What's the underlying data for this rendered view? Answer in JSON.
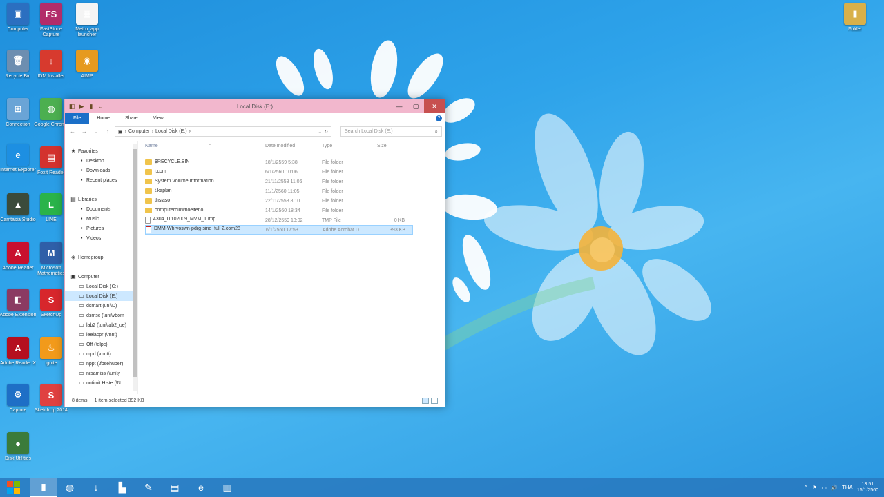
{
  "desktop": {
    "icons": [
      {
        "label": "Computer",
        "glyph": "▣",
        "color": "#2b6fc0"
      },
      {
        "label": "FastStone Capture",
        "glyph": "FS",
        "color": "#b22c6a"
      },
      {
        "label": "Metro_app launcher",
        "glyph": "▦",
        "color": "#f4f4f4"
      },
      {
        "label": "Recycle Bin",
        "glyph": "🗑",
        "color": "#6d8eb0"
      },
      {
        "label": "IDM Installer",
        "glyph": "↓",
        "color": "#d73a2e"
      },
      {
        "label": "AIMP",
        "glyph": "◉",
        "color": "#e69a1f"
      },
      {
        "label": "Connection",
        "glyph": "⊞",
        "color": "#6aa4d6"
      },
      {
        "label": "Google Chrome",
        "glyph": "◍",
        "color": "#4caf50"
      },
      {
        "label": "Internet Explorer",
        "glyph": "e",
        "color": "#1d8fe2"
      },
      {
        "label": "Foxit Reader",
        "glyph": "▤",
        "color": "#d3322e"
      },
      {
        "label": "Camtasia Studio",
        "glyph": "▲",
        "color": "#3b4b3b"
      },
      {
        "label": "LINE",
        "glyph": "L",
        "color": "#2ab34a"
      },
      {
        "label": "Adobe Reader",
        "glyph": "A",
        "color": "#c8102e"
      },
      {
        "label": "Microsoft Mathematics",
        "glyph": "M",
        "color": "#2f5fa8"
      },
      {
        "label": "Adobe Extension",
        "glyph": "◧",
        "color": "#8b3a62"
      },
      {
        "label": "SketchUp",
        "glyph": "S",
        "color": "#d7262c"
      },
      {
        "label": "Adobe Reader X",
        "glyph": "A",
        "color": "#b50f1f"
      },
      {
        "label": "Ignite",
        "glyph": "♨",
        "color": "#f29a1b"
      },
      {
        "label": "Capture",
        "glyph": "⚙",
        "color": "#1e6fc6"
      },
      {
        "label": "SketchUp 2014",
        "glyph": "S",
        "color": "#e04040"
      },
      {
        "label": "Disk Utilities",
        "glyph": "●",
        "color": "#3b7b3b"
      },
      {
        "label": "Folder",
        "glyph": "▮",
        "color": "#d8b04a"
      }
    ]
  },
  "window": {
    "title": "Local Disk (E:)",
    "quick_access": [
      "◧",
      "▶",
      "▮",
      "⌄"
    ],
    "controls": {
      "minimize": "—",
      "maximize": "▢",
      "close": "✕"
    },
    "ribbon_tabs": [
      "File",
      "Home",
      "Share",
      "View"
    ],
    "help": "?",
    "address": {
      "parts": [
        "Computer",
        "Local Disk (E:)"
      ],
      "sep": "›",
      "dropdown": "⌄",
      "refresh": "↻"
    },
    "search_placeholder": "Search Local Disk (E:)",
    "nav_buttons": [
      "←",
      "→",
      "⌄",
      "↑"
    ],
    "nav_pane": {
      "favorites": {
        "label": "Favorites",
        "items": [
          "Desktop",
          "Downloads",
          "Recent places"
        ]
      },
      "libraries": {
        "label": "Libraries",
        "items": [
          "Documents",
          "Music",
          "Pictures",
          "Videos"
        ]
      },
      "homegroup": "Homegroup",
      "computer": {
        "label": "Computer",
        "items": [
          "Local Disk (C:)",
          "Local Disk (E:)",
          "dsmart (uni\\D)",
          "dsmsc (\\uni\\vbom",
          "lab2 (\\uni\\lab2_ue)",
          "leeiacpr (\\mnt)",
          "Off (\\olpc)",
          "mpd (\\mnt\\)",
          "nppt (\\fbsehuper)",
          "nrsamiss (\\uni\\y",
          "nntimit Histe (\\N"
        ]
      }
    },
    "columns": {
      "name": "Name",
      "date": "Date modified",
      "type": "Type",
      "size": "Size"
    },
    "files": [
      {
        "name": "$RECYCLE.BIN",
        "date": "18/1/2559 5:38",
        "type": "File folder",
        "size": "",
        "kind": "folder"
      },
      {
        "name": "i.com",
        "date": "6/1/2560 10:06",
        "type": "File folder",
        "size": "",
        "kind": "folder"
      },
      {
        "name": "System Volume Information",
        "date": "21/11/2558 11:06",
        "type": "File folder",
        "size": "",
        "kind": "folder"
      },
      {
        "name": "t.kaplan",
        "date": "11/1/2560 11:05",
        "type": "File folder",
        "size": "",
        "kind": "folder"
      },
      {
        "name": "thsiaso",
        "date": "22/11/2558 8:10",
        "type": "File folder",
        "size": "",
        "kind": "folder"
      },
      {
        "name": "computerbluwhoeifeno",
        "date": "14/1/2560 18:34",
        "type": "File folder",
        "size": "",
        "kind": "folder"
      },
      {
        "name": "4304_IT102009_MVM_1.imp",
        "date": "28/12/2559 13:02",
        "type": "TMP File",
        "size": "0 KB",
        "kind": "file"
      },
      {
        "name": "DMM-Whrvoswn-pdrg-sine_full 2.com28",
        "date": "6/1/2560 17:53",
        "type": "Adobe Acrobat D...",
        "size": "393 KB",
        "kind": "pdf"
      }
    ],
    "status": {
      "items": "8 items",
      "selected": "1 item selected  392 KB"
    }
  },
  "taskbar": {
    "apps": [
      {
        "name": "file-explorer",
        "glyph": "▮",
        "active": true
      },
      {
        "name": "chrome",
        "glyph": "◍",
        "active": false
      },
      {
        "name": "idm",
        "glyph": "↓",
        "active": false
      },
      {
        "name": "camtasia",
        "glyph": "▙",
        "active": false
      },
      {
        "name": "paint",
        "glyph": "✎",
        "active": false
      },
      {
        "name": "notepad",
        "glyph": "▤",
        "active": false
      },
      {
        "name": "internet-explorer",
        "glyph": "e",
        "active": false
      },
      {
        "name": "winrar",
        "glyph": "▥",
        "active": false
      }
    ],
    "tray": {
      "glyphs": [
        "⌃",
        "⚑",
        "▭",
        "🔊"
      ],
      "lang": "THA",
      "time": "13:51",
      "date": "15/1/2560"
    }
  }
}
